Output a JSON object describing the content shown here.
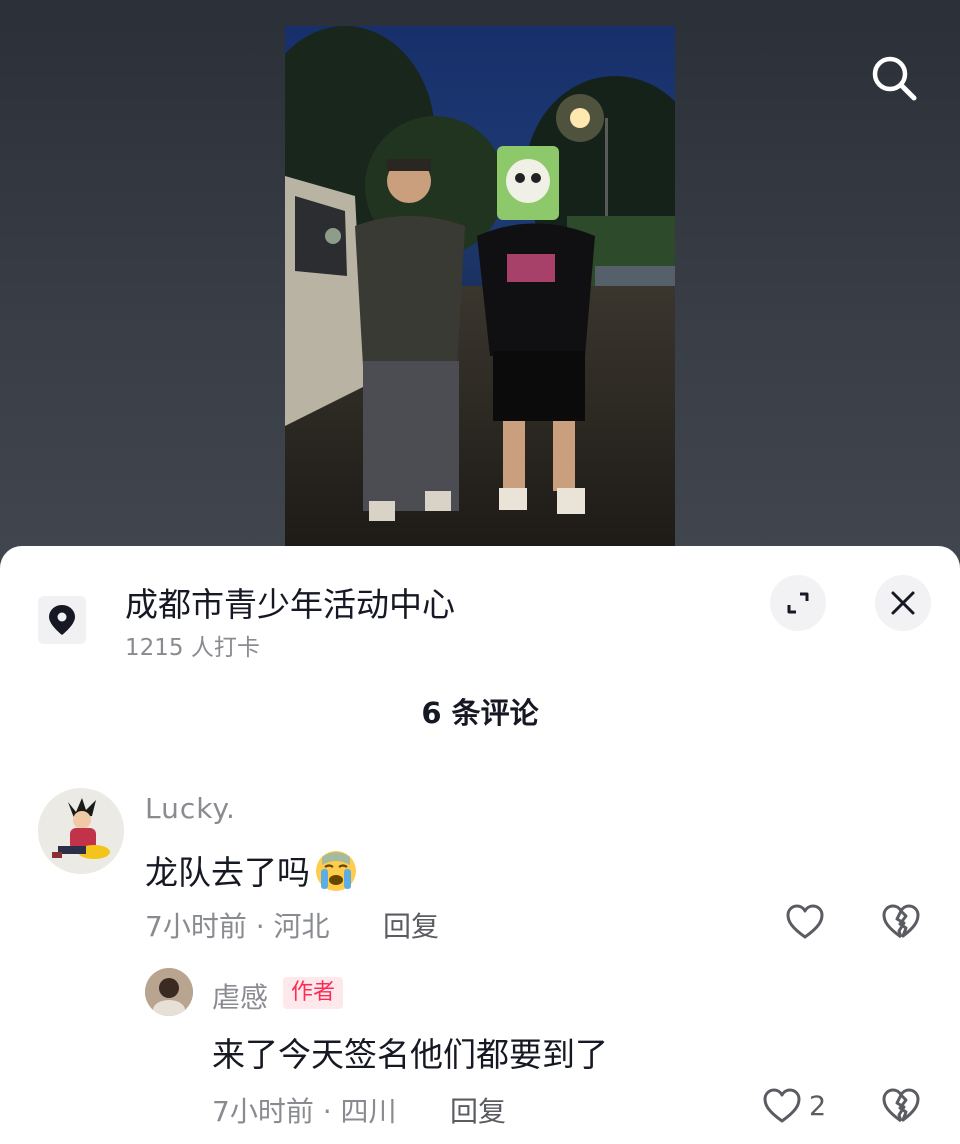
{
  "location": {
    "name": "成都市青少年活动中心",
    "checkins": "1215 人打卡"
  },
  "comments_header": "6 条评论",
  "comments": [
    {
      "username": "Lucky.",
      "text": "龙队去了吗",
      "emoji": "loudly-crying-face",
      "time_location": "7小时前 · 河北",
      "reply_label": "回复"
    }
  ],
  "replies": [
    {
      "username": "虐感",
      "badge": "作者",
      "text": "来了今天签名他们都要到了",
      "time_location": "7小时前 · 四川",
      "reply_label": "回复",
      "like_count": "2"
    }
  ],
  "colors": {
    "accent": "#fe2c55",
    "text_primary": "#161823",
    "text_secondary": "#8a8b91"
  }
}
